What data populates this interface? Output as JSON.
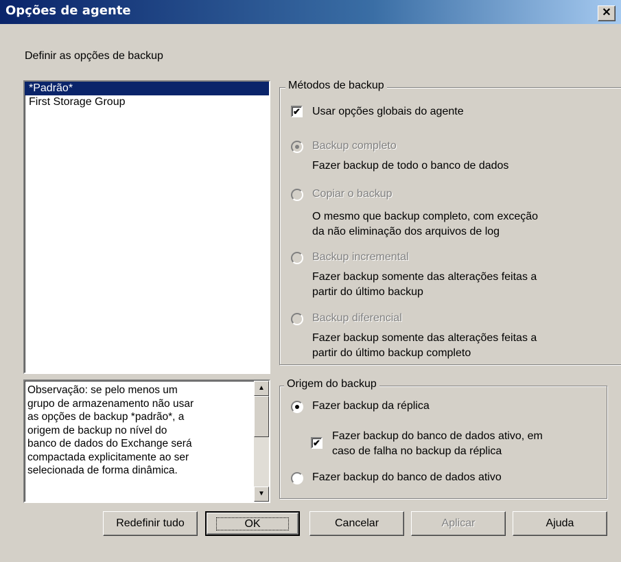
{
  "window": {
    "title": "Opções de agente"
  },
  "header_label": "Definir as opções de backup",
  "groups": {
    "list": [
      "*Padrão*",
      "First Storage Group"
    ]
  },
  "methods": {
    "legend": "Métodos de backup",
    "use_global": "Usar opções globais do agente",
    "options": [
      {
        "label": "Backup completo",
        "desc1": "Fazer backup de todo o banco de dados",
        "desc2": ""
      },
      {
        "label": "Copiar o backup",
        "desc1": "O mesmo que backup completo, com exceção",
        "desc2": "da não eliminação dos arquivos de log"
      },
      {
        "label": "Backup incremental",
        "desc1": "Fazer backup somente das alterações feitas a",
        "desc2": "partir do último backup"
      },
      {
        "label": "Backup diferencial",
        "desc1": "Fazer backup somente das alterações feitas a",
        "desc2": "partir do último backup completo"
      }
    ]
  },
  "note": {
    "lines": [
      "Observação: se pelo menos um",
      "grupo de armazenamento não usar",
      "as opções de backup *padrão*, a",
      "origem de backup no nível do",
      "banco de dados do Exchange será",
      "compactada explicitamente ao ser",
      "selecionada de forma dinâmica."
    ]
  },
  "origin": {
    "legend": "Origem do backup",
    "replica": "Fazer backup da réplica",
    "fallback_1": "Fazer backup do banco de dados ativo, em",
    "fallback_2": "caso de falha no backup da réplica",
    "active": "Fazer backup do banco de dados ativo"
  },
  "buttons": {
    "reset": "Redefinir tudo",
    "ok": "OK",
    "cancel": "Cancelar",
    "apply": "Aplicar",
    "help": "Ajuda"
  }
}
